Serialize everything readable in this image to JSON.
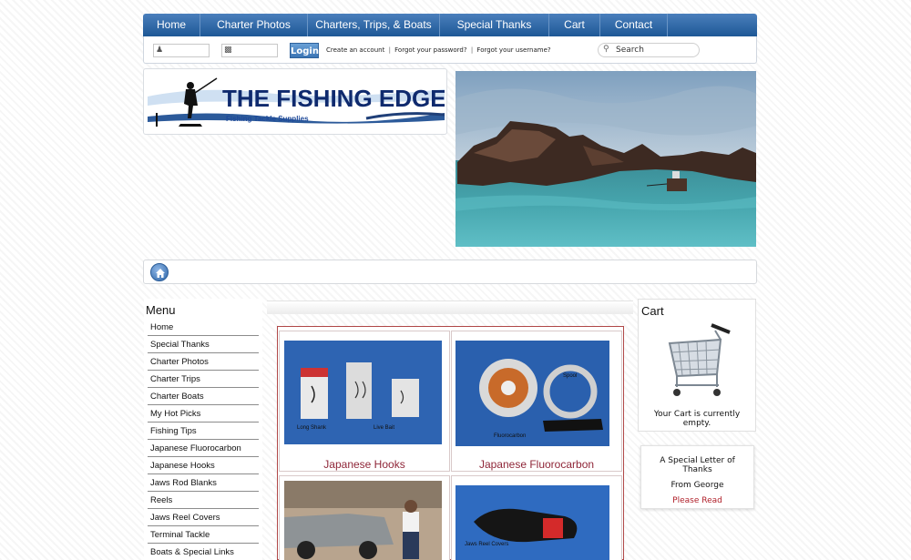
{
  "nav": {
    "items": [
      {
        "label": "Home",
        "w": 63
      },
      {
        "label": "Charter Photos",
        "w": 118
      },
      {
        "label": "Charters, Trips, & Boats",
        "w": 145
      },
      {
        "label": "Special Thanks",
        "w": 120
      },
      {
        "label": "Cart",
        "w": 56
      },
      {
        "label": "Contact",
        "w": 74
      }
    ]
  },
  "login": {
    "button": "Login",
    "create_account": "Create an account",
    "forgot_password": "Forgot your password?",
    "forgot_username": "Forgot your username?",
    "separator": "|",
    "search_placeholder": "Search"
  },
  "logo": {
    "title": "THE FISHING EDGE",
    "subtitle": "Fishing Tackle Supplies"
  },
  "menu": {
    "title": "Menu",
    "items": [
      "Home",
      "Special Thanks",
      "Charter Photos",
      "Charter Trips",
      "Charter Boats",
      "My Hot Picks",
      "Fishing Tips",
      "Japanese Fluorocarbon",
      "Japanese Hooks",
      "Jaws Rod Blanks",
      "Reels",
      "Jaws Reel Covers",
      "Terminal Tackle",
      "Boats & Special Links"
    ]
  },
  "products": [
    {
      "title": "Japanese Hooks",
      "caption1": "Long Shank",
      "caption2": "Live Bait"
    },
    {
      "title": "Japanese Fluorocarbon",
      "caption1": "Fluorocarbon",
      "caption2": "Spool"
    },
    {
      "title": "",
      "caption1": ""
    },
    {
      "title": "",
      "caption1": "Jaws Reel Covers"
    }
  ],
  "cart": {
    "title": "Cart",
    "status": "Your Cart is currently empty."
  },
  "letter": {
    "title": "A Special Letter of Thanks",
    "from": "From George",
    "link": "Please Read"
  },
  "colors": {
    "nav_blue": "#1e5896",
    "accent_red": "#8f2638",
    "product_bg": "#2e64b2"
  }
}
